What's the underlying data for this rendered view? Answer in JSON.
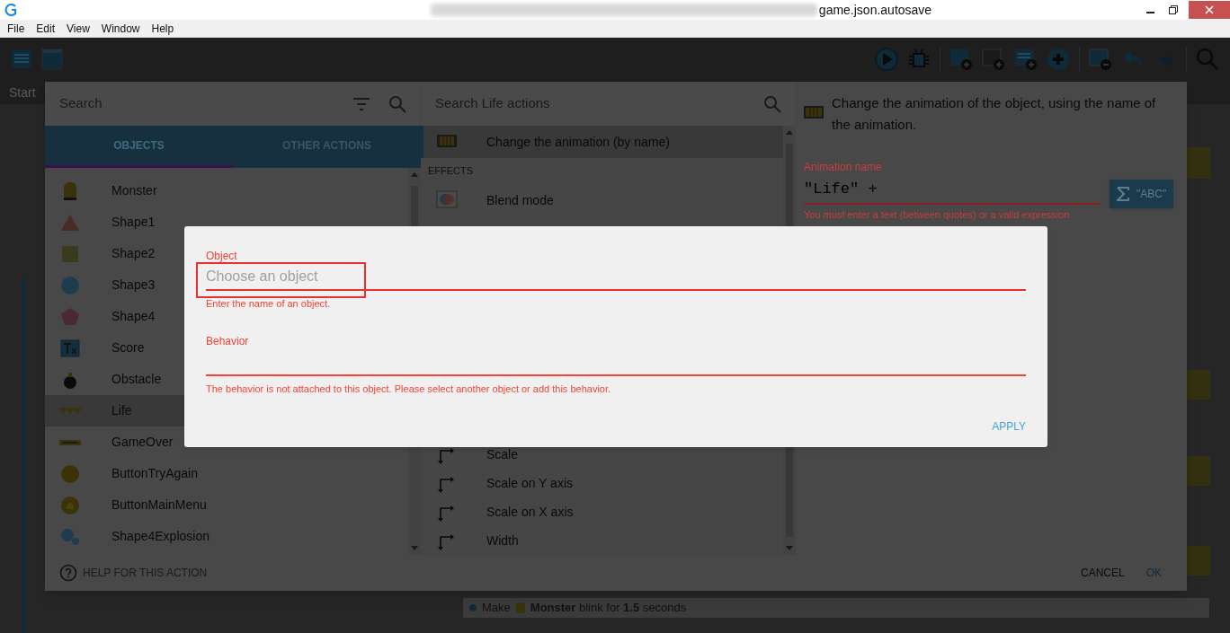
{
  "window": {
    "title": "game.json.autosave"
  },
  "menu": [
    "File",
    "Edit",
    "View",
    "Window",
    "Help"
  ],
  "editor": {
    "scene_tab": "Start",
    "action": {
      "verb": "Make",
      "object": "Monster",
      "rest": "blink for **1.5** seconds"
    }
  },
  "instruction_dialog": {
    "objects_search": {
      "placeholder": "Search"
    },
    "tabs": [
      {
        "label": "OBJECTS",
        "selected": true
      },
      {
        "label": "OTHER ACTIONS",
        "selected": false
      }
    ],
    "objects": [
      {
        "name": "Monster",
        "selected": false
      },
      {
        "name": "Shape1",
        "selected": false
      },
      {
        "name": "Shape2",
        "selected": false
      },
      {
        "name": "Shape3",
        "selected": false
      },
      {
        "name": "Shape4",
        "selected": false
      },
      {
        "name": "Score",
        "selected": false
      },
      {
        "name": "Obstacle",
        "selected": false
      },
      {
        "name": "Life",
        "selected": true
      },
      {
        "name": "GameOver",
        "selected": false
      },
      {
        "name": "ButtonTryAgain",
        "selected": false
      },
      {
        "name": "ButtonMainMenu",
        "selected": false
      },
      {
        "name": "Shape4Explosion",
        "selected": false
      }
    ],
    "actions_search": {
      "placeholder": "Search Life actions"
    },
    "actions_top": [
      {
        "kind": "item",
        "label": "Change the animation (by name)",
        "selected": true
      },
      {
        "kind": "header",
        "label": "EFFECTS"
      },
      {
        "kind": "item",
        "label": "Blend mode",
        "selected": false
      }
    ],
    "actions_bottom": [
      {
        "kind": "item",
        "label": "Scale",
        "selected": false
      },
      {
        "kind": "item",
        "label": "Scale on Y axis",
        "selected": false
      },
      {
        "kind": "item",
        "label": "Scale on X axis",
        "selected": false
      },
      {
        "kind": "item",
        "label": "Width",
        "selected": false
      }
    ],
    "description": "Change the animation of the object, using the name of the animation.",
    "parameter": {
      "label": "Animation name",
      "value": "\"Life\" +",
      "error": "You must enter a text (between quotes) or a valid expression",
      "mode_button": "\"ABC\""
    },
    "help": "HELP FOR THIS ACTION",
    "buttons": [
      "CANCEL",
      "OK"
    ]
  },
  "object_dialog": {
    "fields": [
      {
        "label": "Object",
        "placeholder": "Choose an object",
        "error": "Enter the name of an object.",
        "highlighted": true
      },
      {
        "label": "Behavior",
        "error": "The behavior is not attached to this object. Please select another object or add this behavior.",
        "highlighted": false
      }
    ],
    "button": "APPLY"
  }
}
